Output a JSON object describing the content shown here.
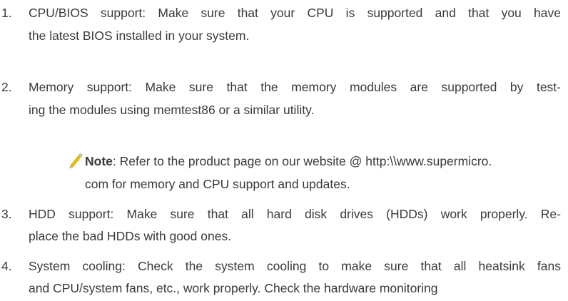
{
  "items": [
    {
      "number": "1.",
      "lines": [
        "CPU/BIOS support: Make sure that your CPU is supported and that you have",
        "the latest BIOS installed in your system."
      ]
    },
    {
      "number": "2.",
      "lines": [
        "Memory support: Make sure that the memory modules are supported by test-",
        "ing the modules using memtest86 or a similar utility."
      ]
    },
    {
      "number": "3.",
      "lines": [
        "HDD support: Make sure that all hard disk drives (HDDs) work properly. Re-",
        "place the bad HDDs with good ones."
      ]
    },
    {
      "number": "4.",
      "lines": [
        "System cooling: Check the system cooling to make sure that all heatsink fans",
        "and CPU/system fans, etc., work properly. Check the hardware monitoring"
      ]
    }
  ],
  "note": {
    "label": "Note",
    "line1": ": Refer to the product page on our website @ http:\\\\www.supermicro.",
    "line2": "com for memory and CPU support and updates.",
    "icon": "pencil-icon"
  }
}
